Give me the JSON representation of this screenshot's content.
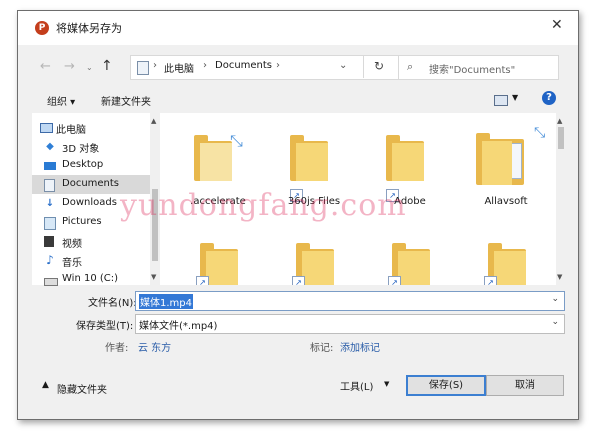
{
  "window": {
    "title": "将媒体另存为"
  },
  "nav": {
    "back": "←",
    "forward": "→",
    "up": "↑",
    "breadcrumb": [
      "此电脑",
      "Documents"
    ],
    "search_placeholder": "搜索\"Documents\""
  },
  "toolbar": {
    "organize": "组织 ▾",
    "new_folder": "新建文件夹"
  },
  "sidebar": {
    "items": [
      {
        "label": "此电脑",
        "icon": "pc-icon"
      },
      {
        "label": "3D 对象",
        "icon": "3d-objects-icon"
      },
      {
        "label": "Desktop",
        "icon": "desktop-icon"
      },
      {
        "label": "Documents",
        "icon": "documents-icon",
        "selected": true
      },
      {
        "label": "Downloads",
        "icon": "download-icon"
      },
      {
        "label": "Pictures",
        "icon": "pictures-icon"
      },
      {
        "label": "视频",
        "icon": "video-icon"
      },
      {
        "label": "音乐",
        "icon": "music-icon"
      },
      {
        "label": "Win 10 (C:)",
        "icon": "drive-icon"
      }
    ]
  },
  "files": [
    {
      "name": ".accelerate",
      "icon": "folder-icon"
    },
    {
      "name": "360js Files",
      "icon": "folder-shortcut-icon"
    },
    {
      "name": "Adobe",
      "icon": "folder-shortcut-icon"
    },
    {
      "name": "Allavsoft",
      "icon": "folder-icon"
    }
  ],
  "form": {
    "filename_label": "文件名(N):",
    "filename_value": "媒体1.mp4",
    "filetype_label": "保存类型(T):",
    "filetype_value": "媒体文件(*.mp4)",
    "author_label": "作者:",
    "author_value": "云 东方",
    "tags_label": "标记:",
    "tags_value": "添加标记"
  },
  "footer": {
    "hide_folders": "隐藏文件夹",
    "tools": "工具(L)",
    "save": "保存(S)",
    "cancel": "取消"
  },
  "watermark": "yundongfang.com",
  "colors": {
    "accent": "#3378d6",
    "folder": "#f6d777",
    "brand": "#c43e1c"
  }
}
